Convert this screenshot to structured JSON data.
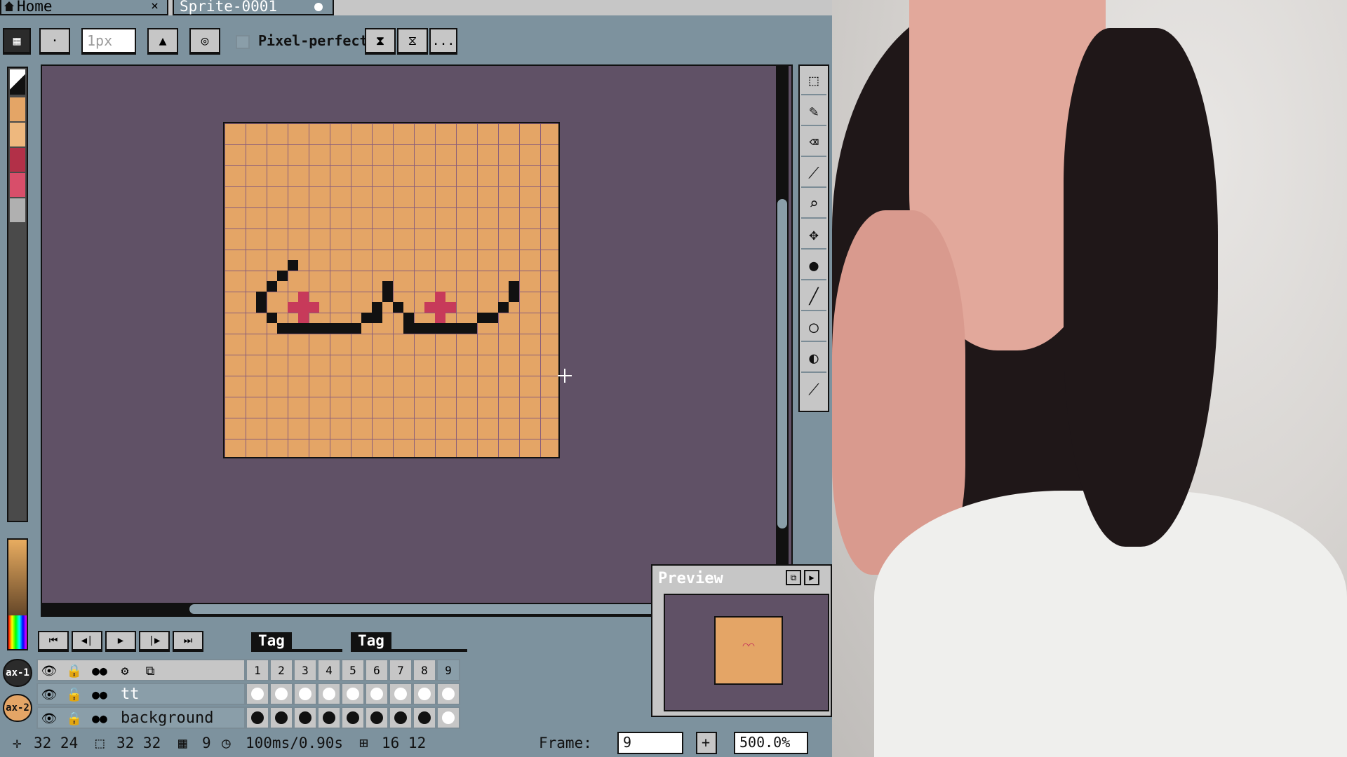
{
  "tabs": {
    "home_label": "Home",
    "sprite_label": "Sprite-0001",
    "close_glyph": "×"
  },
  "toolbar": {
    "brush_size": "1px",
    "pixel_perfect_label": "Pixel-perfect",
    "more_label": "..."
  },
  "canvas": {
    "background_color": "#605166",
    "sprite_color": "#e4a566",
    "ink_color": "#111111",
    "accent_color": "#c73a5a"
  },
  "tools": [
    "marquee-tool",
    "pencil-tool",
    "eraser-tool",
    "eyedropper-tool",
    "zoom-tool",
    "move-tool",
    "fill-tool",
    "line-tool",
    "ellipse-tool",
    "blur-tool",
    "brush-tool"
  ],
  "timeline": {
    "tags": [
      "Tag",
      "Tag"
    ],
    "frames": [
      "1",
      "2",
      "3",
      "4",
      "5",
      "6",
      "7",
      "8",
      "9"
    ],
    "layers": [
      {
        "name": "tt"
      },
      {
        "name": "background"
      }
    ]
  },
  "preview": {
    "title": "Preview"
  },
  "layer_badges": [
    "ax-1",
    "ax-2"
  ],
  "status": {
    "cursor_pos": "32 24",
    "sprite_size": "32 32",
    "frame_count": "9",
    "duration": "100ms/0.90s",
    "grid": "16 12",
    "frame_label": "Frame:",
    "frame_value": "9",
    "zoom": "500.0%"
  }
}
